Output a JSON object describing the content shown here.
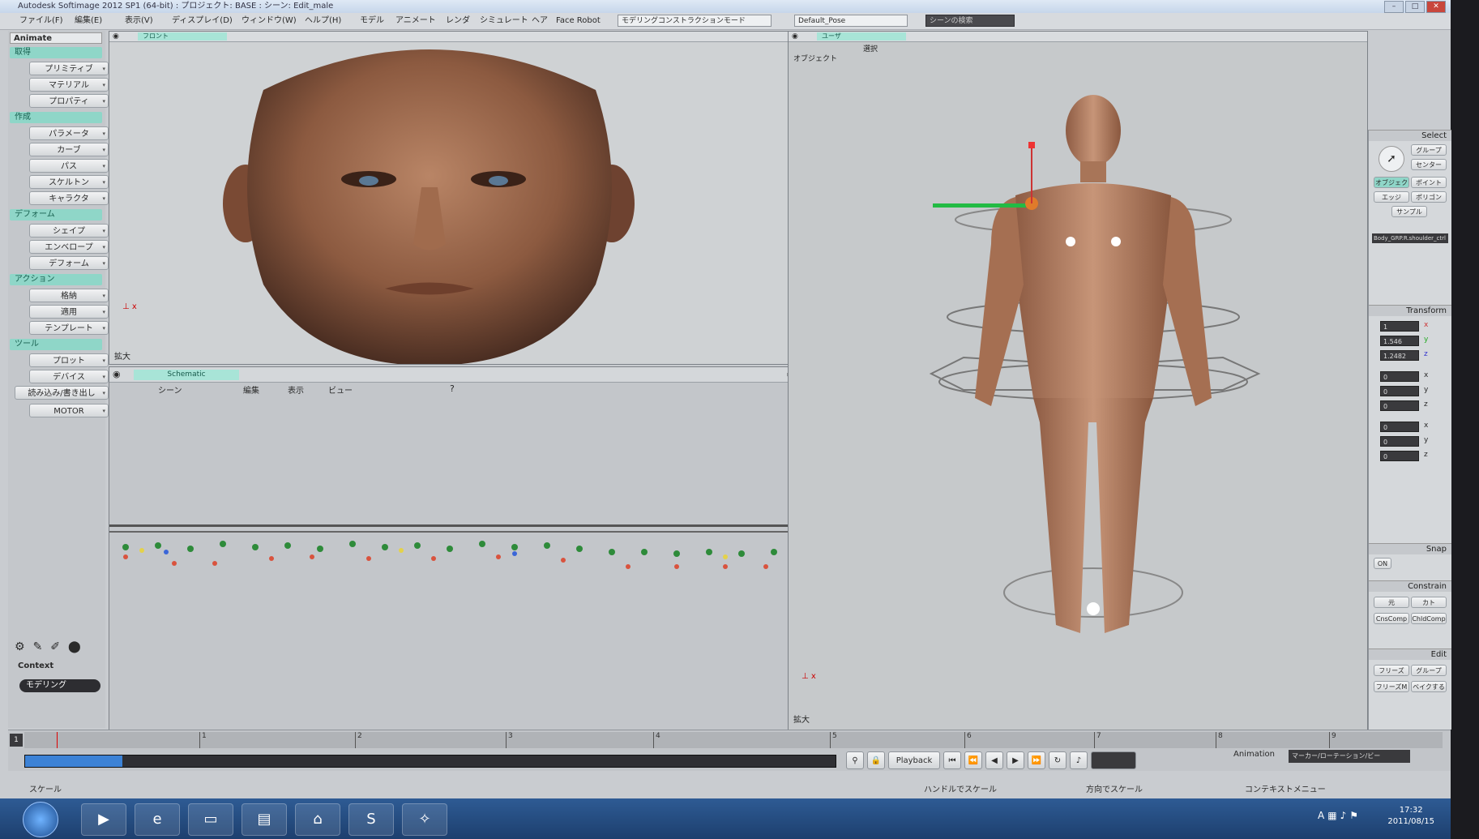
{
  "titlebar": {
    "title": "Autodesk Softimage 2012 SP1 (64-bit) : プロジェクト: BASE : シーン: Edit_male"
  },
  "menubar": {
    "items": [
      "ファイル(F)",
      "編集(E)",
      "表示(V)",
      "ディスプレイ(D)",
      "ウィンドウ(W)",
      "ヘルプ(H)",
      "モデル",
      "アニメート",
      "レンダ",
      "シミュレート",
      "ヘア",
      "Face Robot"
    ],
    "mode": "モデリングコンストラクションモード",
    "preset": "Default_Pose",
    "search": "シーンの検索"
  },
  "left_palette": {
    "mode": "Animate",
    "sections": [
      {
        "title": "取得",
        "items": [
          "プリミティブ",
          "マテリアル",
          "プロパティ"
        ]
      },
      {
        "title": "作成",
        "items": [
          "パラメータ",
          "カーブ",
          "パス",
          "スケルトン",
          "キャラクタ"
        ]
      },
      {
        "title": "デフォーム",
        "items": [
          "シェイプ",
          "エンベロープ",
          "デフォーム"
        ]
      },
      {
        "title": "アクション",
        "items": [
          "格納",
          "適用",
          "テンプレート"
        ]
      },
      {
        "title": "ツール",
        "items": [
          "プロット",
          "デバイス",
          "読み込み/書き出し",
          "MOTOR"
        ]
      }
    ],
    "context_label": "Context",
    "context_value": "モデリング"
  },
  "viewport_left": {
    "camera": "フロント",
    "label": "拡大"
  },
  "viewport_right": {
    "camera": "ユーザ",
    "label": "拡大",
    "info_label": "オブジェクト",
    "info_value": "選択"
  },
  "schematic": {
    "title": "Schematic",
    "menus": [
      "シーン",
      "編集",
      "表示",
      "ビュー"
    ]
  },
  "right_palette": {
    "select_header": "Select",
    "select_buttons": [
      "グループ",
      "センター",
      "オブジェクト",
      "ポイント",
      "エッジ",
      "ポリゴン",
      "サンプル"
    ],
    "selected_object": "Body_GRP.R.shoulder_ctrl",
    "transform_header": "Transform",
    "transform_values": [
      "1",
      "1.546",
      "1.2482",
      "0",
      "0",
      "0",
      "0",
      "0",
      "0"
    ],
    "transform_axes": [
      "x",
      "y",
      "z",
      "x",
      "y",
      "z",
      "x",
      "y",
      "z"
    ],
    "snap_header": "Snap",
    "snap_buttons": [
      "ON"
    ],
    "constrain_header": "Constrain",
    "constrain_buttons": [
      "元",
      "カト",
      "CnsComp",
      "ChldComp"
    ],
    "edit_header": "Edit",
    "edit_buttons": [
      "フリーズ",
      "グループ",
      "フリーズM",
      "ベイクする"
    ]
  },
  "timeline": {
    "ticks": [
      "1",
      "2",
      "3",
      "4",
      "5",
      "6",
      "7",
      "8",
      "9"
    ],
    "frame": "1",
    "playback_label": "Playback",
    "animation_label": "Animation",
    "keying": "マーカー/ローテーション/ビー",
    "progress": 0.12
  },
  "status": {
    "left": "スケール",
    "middle": "ハンドルでスケール",
    "right": "方向でスケール",
    "far_right": "コンテキストメニュー"
  },
  "taskbar": {
    "time": "17:32",
    "date": "2011/08/15"
  }
}
